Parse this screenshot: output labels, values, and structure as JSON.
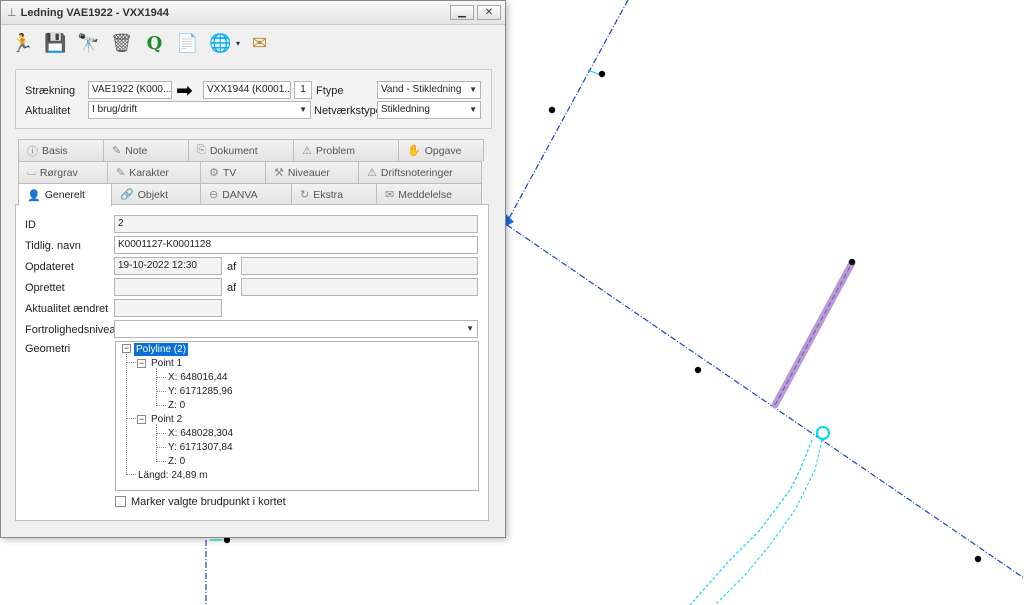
{
  "window": {
    "title": "Ledning VAE1922 - VXX1944",
    "minimize_label": "▁",
    "close_label": "✕"
  },
  "toolbar": {
    "buttons": [
      {
        "name": "exit-icon",
        "glyph": "🏃",
        "color": "#1a9a1a"
      },
      {
        "name": "save-icon",
        "glyph": "💾",
        "color": "#2a4fa8"
      },
      {
        "name": "binoculars-icon",
        "glyph": "🔭",
        "color": "#333333"
      },
      {
        "name": "delete-icon",
        "glyph": "🗑",
        "color": "#555555"
      },
      {
        "name": "q-icon",
        "glyph": "Q",
        "color": "#1e8c2a"
      },
      {
        "name": "document-icon",
        "glyph": "📄",
        "color": "#3c6fb4"
      },
      {
        "name": "globe-icon",
        "glyph": "🌐",
        "color": "#2a7ac8"
      },
      {
        "name": "mail-icon",
        "glyph": "✉",
        "color": "#b08a2a"
      }
    ],
    "dropdown_caret": "▾"
  },
  "header": {
    "straekning_label": "Strækning",
    "from_value": "VAE1922 (K000...",
    "arrow": "➡",
    "to_value": "VXX1944 (K0001...",
    "count_value": "1",
    "ftype_label": "Ftype",
    "ftype_value": "Vand - Stikledning",
    "aktualitet_label": "Aktualitet",
    "aktualitet_value": "I brug/drift",
    "netvaerkstype_label": "Netværkstype",
    "netvaerkstype_value": "Stikledning"
  },
  "tabs": {
    "row1": [
      {
        "label": "Basis",
        "icon": "ⓘ"
      },
      {
        "label": "Note",
        "icon": "✎"
      },
      {
        "label": "Dokument",
        "icon": "⎘"
      },
      {
        "label": "Problem",
        "icon": "⚠"
      },
      {
        "label": "Opgave",
        "icon": "✋"
      }
    ],
    "row2": [
      {
        "label": "Rørgrav",
        "icon": "⌴"
      },
      {
        "label": "Karakter",
        "icon": "✎"
      },
      {
        "label": "TV",
        "icon": "⚙"
      },
      {
        "label": "Niveauer",
        "icon": "⚒"
      },
      {
        "label": "Driftsnoteringer",
        "icon": "⚠"
      }
    ],
    "row3": [
      {
        "label": "Generelt",
        "icon": "👤",
        "active": true
      },
      {
        "label": "Objekt",
        "icon": "🔗"
      },
      {
        "label": "DANVA",
        "icon": "⊖"
      },
      {
        "label": "Ekstra",
        "icon": "↻"
      },
      {
        "label": "Meddelelse",
        "icon": "✉"
      }
    ]
  },
  "general": {
    "id_label": "ID",
    "id_value": "2",
    "tidlig_navn_label": "Tidlig. navn",
    "tidlig_navn_value": "K0001127-K0001128",
    "opdateret_label": "Opdateret",
    "opdateret_value": "19-10-2022 12:30",
    "af_label": "af",
    "opdateret_af_value": "",
    "oprettet_label": "Oprettet",
    "oprettet_value": "",
    "oprettet_af_value": "",
    "aktualitet_aendret_label": "Aktualitet ændret",
    "aktualitet_aendret_value": "",
    "fortrolighed_label": "Fortrolighedsniveau",
    "fortrolighed_value": "",
    "geometri_label": "Geometri",
    "marker_label": "Marker valgte brudpunkt i kortet",
    "marker_checked": false
  },
  "geometry_tree": {
    "root": "Polyline (2)",
    "point1": "Point 1",
    "p1_x": "X: 648016,44",
    "p1_y": "Y: 6171285,96",
    "p1_z": "Z: 0",
    "point2": "Point 2",
    "p2_x": "X: 648028,304",
    "p2_y": "Y: 6171307,84",
    "p2_z": "Z: 0",
    "length": "Längd: 24,89 m",
    "collapse_glyph": "−"
  },
  "map": {
    "line_color": "#1a3fd6",
    "service_color": "#00d8f0",
    "selected_color": "#b79ad6",
    "node_color": "#000000"
  }
}
